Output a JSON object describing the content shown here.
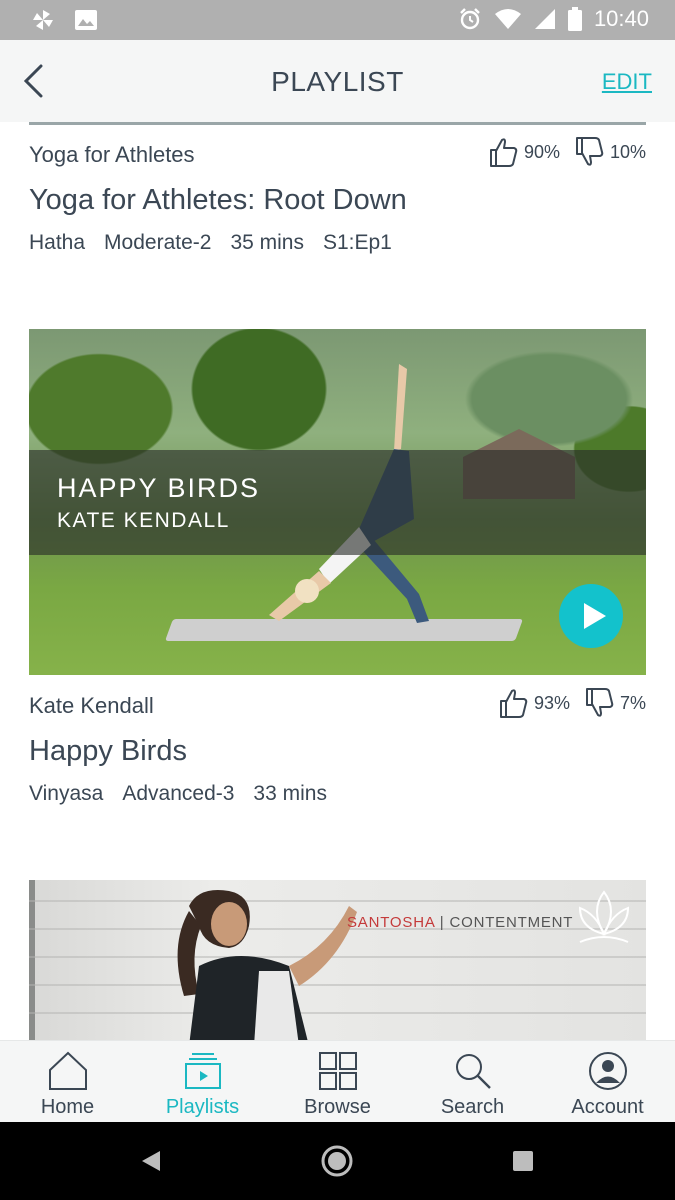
{
  "status_bar": {
    "time": "10:40",
    "icons": [
      "pinwheel-icon",
      "image-icon",
      "alarm-icon",
      "wifi-icon",
      "signal-icon",
      "battery-icon"
    ]
  },
  "header": {
    "title": "PLAYLIST",
    "edit_label": "EDIT",
    "back_icon": "chevron-left-icon"
  },
  "colors": {
    "accent": "#1bb8c2",
    "text": "#3b4754",
    "bar_bg": "#f5f6f6"
  },
  "videos": [
    {
      "series": "Yoga for Athletes",
      "title": "Yoga for Athletes: Root Down",
      "style": "Hatha",
      "level": "Moderate-2",
      "duration": "35 mins",
      "episode": "S1:Ep1",
      "likes": "90%",
      "dislikes": "10%"
    },
    {
      "banner_title": "HAPPY BIRDS",
      "banner_subtitle": "KATE KENDALL",
      "series": "Kate Kendall",
      "title": "Happy Birds",
      "style": "Vinyasa",
      "level": "Advanced-3",
      "duration": "33 mins",
      "likes": "93%",
      "dislikes": "7%"
    },
    {
      "brand_left": "SANTOSHA",
      "brand_sep": "|",
      "brand_right": "CONTENTMENT"
    }
  ],
  "tabs": [
    {
      "label": "Home",
      "icon": "home-icon"
    },
    {
      "label": "Playlists",
      "icon": "playlists-icon",
      "active": true
    },
    {
      "label": "Browse",
      "icon": "grid-icon"
    },
    {
      "label": "Search",
      "icon": "search-icon"
    },
    {
      "label": "Account",
      "icon": "account-icon"
    }
  ],
  "system_nav": [
    "back-triangle-icon",
    "home-circle-icon",
    "recents-square-icon"
  ]
}
